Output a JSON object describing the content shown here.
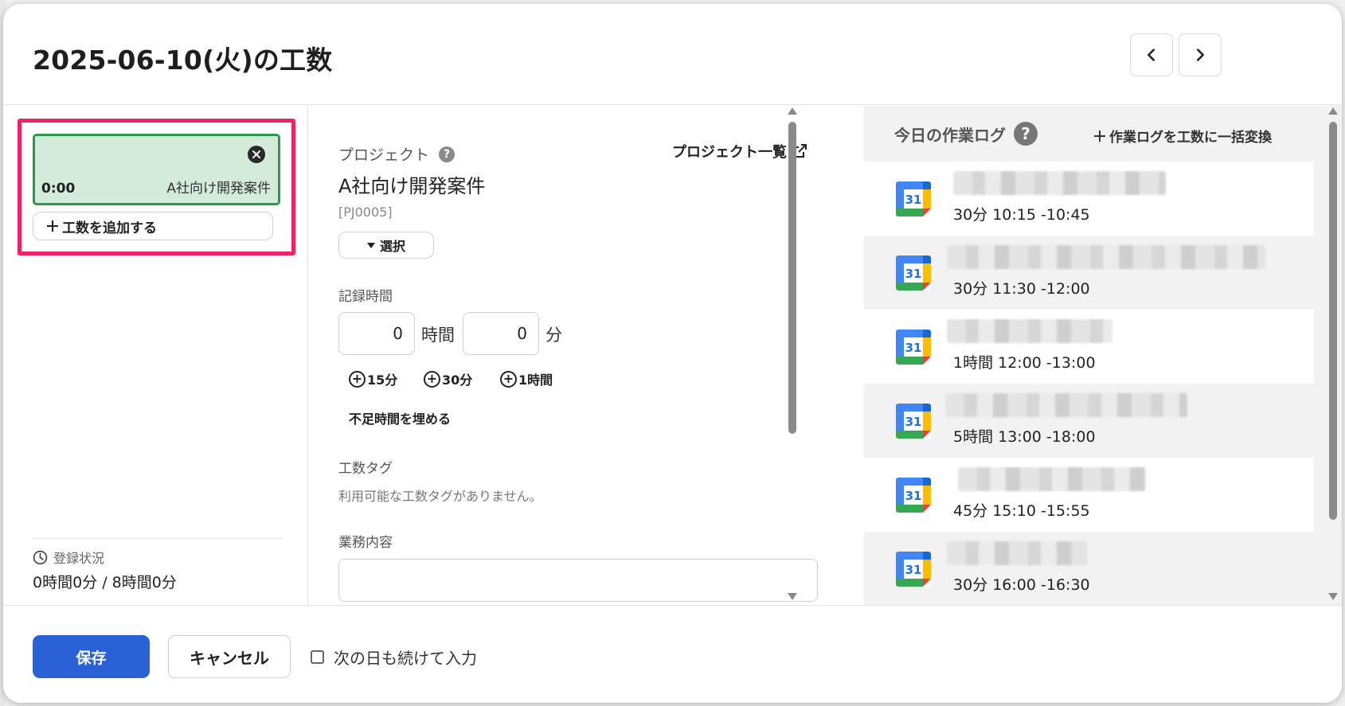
{
  "header": {
    "title": "2025-06-10(火)の工数"
  },
  "left": {
    "entries": [
      {
        "time": "0:00",
        "project": "A社向け開発案件"
      }
    ],
    "add_entry_label": "工数を追加する",
    "status_label": "登録状況",
    "status_value": "0時間0分 / 8時間0分"
  },
  "form": {
    "project_label": "プロジェクト",
    "project_list_link": "プロジェクト一覧",
    "project_name": "A社向け開発案件",
    "project_code": "[PJ0005]",
    "select_label": "選択",
    "record_time_label": "記録時間",
    "hours_value": "0",
    "hours_unit": "時間",
    "minutes_value": "0",
    "minutes_unit": "分",
    "quick_add": [
      "15分",
      "30分",
      "1時間"
    ],
    "fill_shortage_label": "不足時間を埋める",
    "tag_label": "工数タグ",
    "tag_empty_text": "利用可能な工数タグがありません。",
    "work_content_label": "業務内容",
    "work_content_value": ""
  },
  "log": {
    "title": "今日の作業ログ",
    "convert_all_label": "作業ログを工数に一括変換",
    "calendar_icon_text": "31",
    "items": [
      {
        "time": "30分  10:15 -10:45"
      },
      {
        "time": "30分  11:30 -12:00"
      },
      {
        "time": "1時間  12:00 -13:00"
      },
      {
        "time": "5時間  13:00 -18:00"
      },
      {
        "time": "45分  15:10 -15:55"
      },
      {
        "time": "30分  16:00 -16:30"
      }
    ]
  },
  "footer": {
    "save_label": "保存",
    "cancel_label": "キャンセル",
    "continue_label": "次の日も続けて入力",
    "continue_checked": false
  },
  "colors": {
    "primary": "#2a62d6",
    "entry_bg": "#d2ecd9",
    "entry_border": "#2e9a4c",
    "highlight": "#ee2266"
  }
}
